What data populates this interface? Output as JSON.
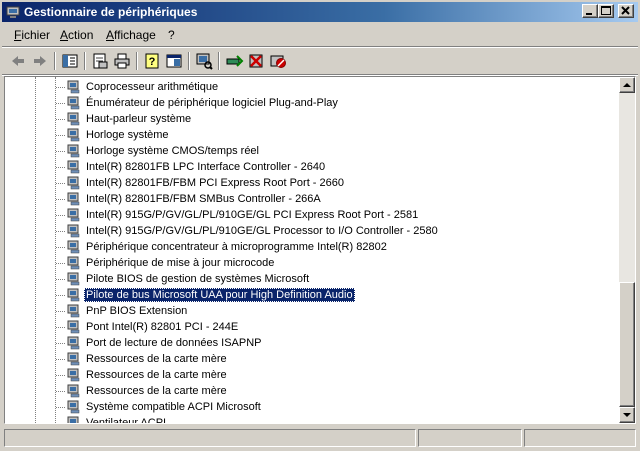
{
  "window": {
    "title": "Gestionnaire de périphériques"
  },
  "menubar": {
    "items": [
      "Fichier",
      "Action",
      "Affichage",
      "?"
    ]
  },
  "toolbar": {
    "buttons": [
      "back-arrow-icon",
      "forward-arrow-icon",
      "show-hide-tree-icon",
      "properties-icon",
      "print-icon",
      "help-icon",
      "view-icon",
      "scan-hardware-icon",
      "update-driver-icon",
      "uninstall-icon",
      "disable-device-icon"
    ]
  },
  "tree": {
    "items": [
      "Coprocesseur arithmétique",
      "Énumérateur de périphérique logiciel Plug-and-Play",
      "Haut-parleur système",
      "Horloge système",
      "Horloge système CMOS/temps réel",
      "Intel(R) 82801FB LPC Interface Controller - 2640",
      "Intel(R) 82801FB/FBM PCI Express Root Port - 2660",
      "Intel(R) 82801FB/FBM SMBus Controller - 266A",
      "Intel(R) 915G/P/GV/GL/PL/910GE/GL PCI Express Root Port - 2581",
      "Intel(R) 915G/P/GV/GL/PL/910GE/GL Processor to I/O Controller - 2580",
      "Périphérique concentrateur à microprogramme Intel(R) 82802",
      "Périphérique de mise à jour microcode",
      "Pilote BIOS de gestion de systèmes Microsoft",
      "Pilote de bus Microsoft UAA pour High Definition Audio",
      "PnP BIOS Extension",
      "Pont Intel(R) 82801 PCI - 244E",
      "Port de lecture de données ISAPNP",
      "Ressources de la carte mère",
      "Ressources de la carte mère",
      "Ressources de la carte mère",
      "Système compatible ACPI Microsoft",
      "Ventilateur ACPI"
    ],
    "selected_index": 13
  },
  "colors": {
    "titlebar": "#0a246a",
    "selection": "#0a246a",
    "face": "#d4d0c8"
  }
}
